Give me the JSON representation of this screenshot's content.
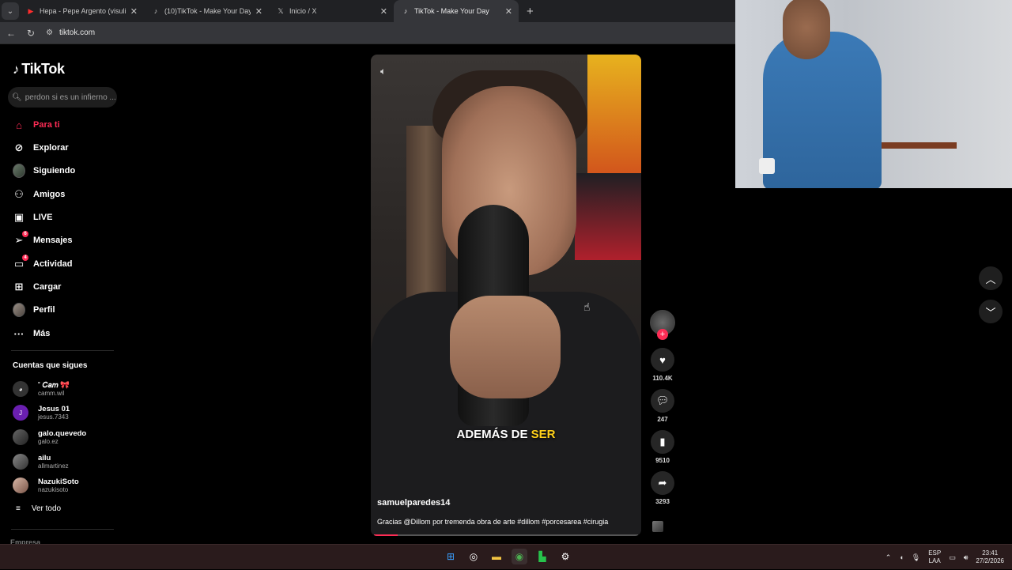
{
  "browser": {
    "tabs": [
      {
        "title": "Hepa - Pepe Argento (visulizer)",
        "icon": "youtube-icon",
        "active": false
      },
      {
        "title": "(10)TikTok - Make Your Day",
        "icon": "tiktok-icon",
        "active": false
      },
      {
        "title": "Inicio / X",
        "icon": "x-icon",
        "active": false
      },
      {
        "title": "TikTok - Make Your Day",
        "icon": "tiktok-icon",
        "active": true
      }
    ],
    "url": "tiktok.com"
  },
  "sidebar": {
    "logo": "TikTok",
    "search_placeholder": "perdon si es un infierno ...",
    "nav": [
      {
        "label": "Para ti",
        "icon": "home-icon",
        "active": true
      },
      {
        "label": "Explorar",
        "icon": "compass-icon"
      },
      {
        "label": "Siguiendo",
        "icon": "avatar-icon"
      },
      {
        "label": "Amigos",
        "icon": "friends-icon"
      },
      {
        "label": "LIVE",
        "icon": "live-icon"
      },
      {
        "label": "Mensajes",
        "icon": "messages-icon",
        "badge": "6"
      },
      {
        "label": "Actividad",
        "icon": "activity-icon",
        "badge": "4"
      },
      {
        "label": "Cargar",
        "icon": "upload-icon"
      },
      {
        "label": "Perfil",
        "icon": "profile-icon"
      },
      {
        "label": "Más",
        "icon": "more-icon"
      }
    ],
    "following_title": "Cuentas que sigues",
    "following": [
      {
        "name": "˚ 𝐶𝑎𝑚 🎀",
        "handle": "camm.wil"
      },
      {
        "name": "Jesus 01",
        "handle": "jesus.7343",
        "initial": "J"
      },
      {
        "name": "galo.quevedo",
        "handle": "galo.ez"
      },
      {
        "name": "ailu",
        "handle": "allmartinez"
      },
      {
        "name": "NazukiSoto",
        "handle": "nazukisoto"
      }
    ],
    "see_all": "Ver todo",
    "company": "Empresa"
  },
  "video": {
    "caption_white": "ADEMÁS DE ",
    "caption_highlight": "SER",
    "author": "samuelparedes14",
    "description": "Gracias @Dillom por tremenda obra de arte #dillom #porcesarea #cirugia",
    "progress": 0.09
  },
  "actions": {
    "likes": "110.4K",
    "comments": "247",
    "saves": "9510",
    "shares": "3293"
  },
  "taskbar": {
    "lang_top": "ESP",
    "lang_bottom": "LAA",
    "time": "23:41",
    "date": "27/2/2026"
  },
  "colors": {
    "accent": "#fe2c55",
    "caption_highlight": "#ffd11a",
    "background": "#000000"
  }
}
